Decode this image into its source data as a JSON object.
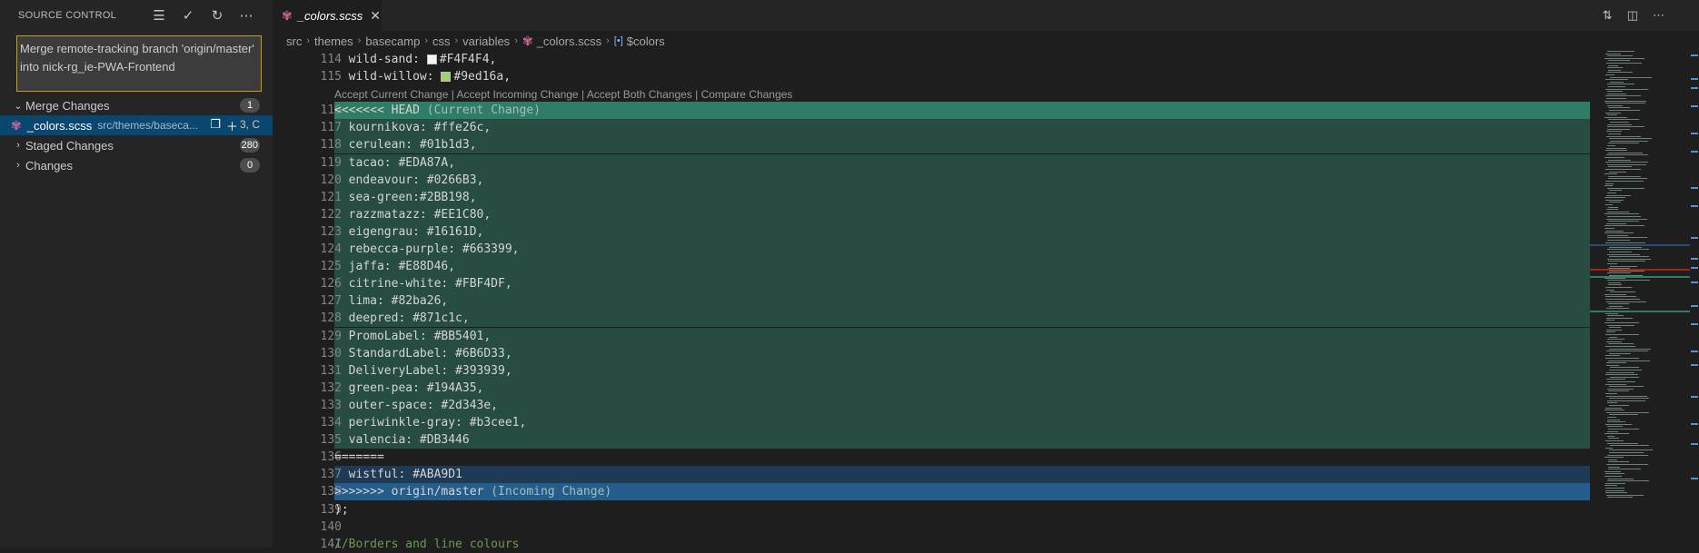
{
  "sidebar": {
    "title": "SOURCE CONTROL",
    "actions": [
      "tree-view-icon",
      "check-icon",
      "refresh-icon",
      "more-icon"
    ],
    "commit_message": "Merge remote-tracking branch 'origin/master' into nick-rg_ie-PWA-Frontend",
    "sections": {
      "merge": {
        "label": "Merge Changes",
        "count": "1"
      },
      "staged": {
        "label": "Staged Changes",
        "count": "280"
      },
      "changes": {
        "label": "Changes",
        "count": "0"
      }
    },
    "file": {
      "name": "_colors.scss",
      "path": "src/themes/baseca...",
      "status": "3, C"
    }
  },
  "editor": {
    "tab_label": "_colors.scss",
    "breadcrumbs": [
      "src",
      "themes",
      "basecamp",
      "css",
      "variables",
      "_colors.scss",
      "$colors"
    ],
    "codelens": "Accept Current Change | Accept Incoming Change | Accept Both Changes | Compare Changes",
    "lines": [
      {
        "n": "114",
        "t": "  wild-sand: ",
        "swatch": "#F4F4F4",
        "v": "#F4F4F4,",
        "kind": "normal"
      },
      {
        "n": "115",
        "t": "  wild-willow: ",
        "swatch": "#9ed16a",
        "v": "#9ed16a,",
        "kind": "normal"
      },
      {
        "n": "116",
        "t": "<<<<<<< HEAD ",
        "suffix": "(Current Change)",
        "kind": "current-head"
      },
      {
        "n": "117",
        "t": "  kournikova: #ffe26c,",
        "kind": "current"
      },
      {
        "n": "118",
        "t": "  cerulean: #01b1d3,",
        "kind": "current"
      },
      {
        "n": "119",
        "t": "  tacao: #EDA87A,",
        "kind": "current"
      },
      {
        "n": "120",
        "t": "  endeavour: #0266B3,",
        "kind": "current"
      },
      {
        "n": "121",
        "t": "  sea-green:#2BB198,",
        "kind": "current"
      },
      {
        "n": "122",
        "t": "  razzmatazz: #EE1C80,",
        "kind": "current"
      },
      {
        "n": "123",
        "t": "  eigengrau: #16161D,",
        "kind": "current"
      },
      {
        "n": "124",
        "t": "  rebecca-purple: #663399,",
        "kind": "current"
      },
      {
        "n": "125",
        "t": "  jaffa: #E88D46,",
        "kind": "current"
      },
      {
        "n": "126",
        "t": "  citrine-white: #FBF4DF,",
        "kind": "current"
      },
      {
        "n": "127",
        "t": "  lima: #82ba26,",
        "kind": "current"
      },
      {
        "n": "128",
        "t": "  deepred: #871c1c,",
        "kind": "current"
      },
      {
        "n": "129",
        "t": "  PromoLabel: #BB5401,",
        "kind": "current"
      },
      {
        "n": "130",
        "t": "  StandardLabel: #6B6D33,",
        "kind": "current"
      },
      {
        "n": "131",
        "t": "  DeliveryLabel: #393939,",
        "kind": "current"
      },
      {
        "n": "132",
        "t": "  green-pea: #194A35,",
        "kind": "current"
      },
      {
        "n": "133",
        "t": "  outer-space: #2d343e,",
        "kind": "current"
      },
      {
        "n": "134",
        "t": "  periwinkle-gray: #b3cee1,",
        "kind": "current"
      },
      {
        "n": "135",
        "t": "  valencia: #DB3446",
        "kind": "current"
      },
      {
        "n": "136",
        "t": "=======",
        "kind": "normal"
      },
      {
        "n": "137",
        "t": "  wistful: #ABA9D1",
        "kind": "incoming"
      },
      {
        "n": "138",
        "t": ">>>>>>> origin/master ",
        "suffix": "(Incoming Change)",
        "kind": "incoming-head"
      },
      {
        "n": "139",
        "t": ");",
        "kind": "normal"
      },
      {
        "n": "140",
        "t": "",
        "kind": "normal"
      },
      {
        "n": "141",
        "t": "//Borders and line colours",
        "kind": "comment"
      }
    ]
  }
}
